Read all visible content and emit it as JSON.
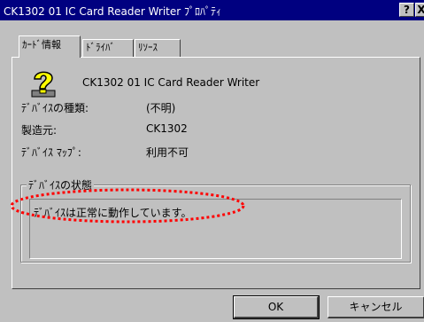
{
  "window": {
    "title": "CK1302 01 IC Card Reader Writer ﾌﾟﾛﾊﾟﾃｨ",
    "help_glyph": "?",
    "close_glyph": "X"
  },
  "tabs": [
    {
      "label": "ｶｰﾄﾞ情報"
    },
    {
      "label": "ﾄﾞﾗｲﾊﾞ"
    },
    {
      "label": "ﾘｿｰｽ"
    }
  ],
  "device": {
    "icon": "unknown-device-question-icon",
    "name": "CK1302 01 IC Card Reader Writer"
  },
  "properties": [
    {
      "label": "ﾃﾞﾊﾞｲｽの種類:",
      "value": "(不明)"
    },
    {
      "label": "製造元:",
      "value": "CK1302"
    },
    {
      "label": "ﾃﾞﾊﾞｲｽ ﾏｯﾌﾟ:",
      "value": "利用不可"
    }
  ],
  "status_group": {
    "legend": "ﾃﾞﾊﾞｲｽの状態",
    "text": "ﾃﾞﾊﾞｲｽは正常に動作しています。",
    "highlight_color": "#ff0000"
  },
  "buttons": {
    "ok": "OK",
    "cancel": "キャンセル"
  }
}
